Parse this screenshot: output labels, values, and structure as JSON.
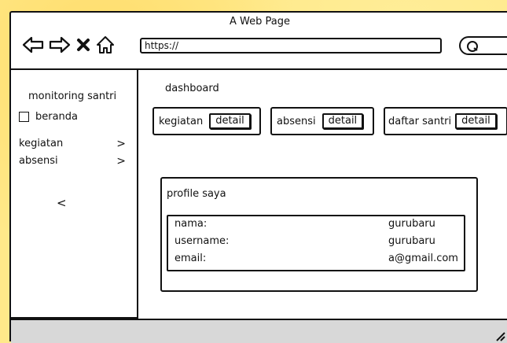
{
  "browser": {
    "title": "A Web Page",
    "url": "https://",
    "icons": [
      "back-arrow-icon",
      "forward-arrow-icon",
      "close-x-icon",
      "home-icon",
      "search-icon"
    ]
  },
  "sidebar": {
    "title": "monitoring santri",
    "home_label": "beranda",
    "items": [
      {
        "label": "kegiatan",
        "chevron": ">"
      },
      {
        "label": "absensi",
        "chevron": ">"
      }
    ],
    "collapse": "<"
  },
  "main": {
    "heading": "dashboard",
    "cards": [
      {
        "label": "kegiatan",
        "button": "detail"
      },
      {
        "label": "absensi",
        "button": "detail"
      },
      {
        "label": "daftar santri",
        "button": "detail"
      }
    ],
    "profile": {
      "title": "profile saya",
      "rows": [
        {
          "key": "nama:",
          "value": "gurubaru"
        },
        {
          "key": "username:",
          "value": "gurubaru"
        },
        {
          "key": "email:",
          "value": "a@gmail.com"
        }
      ]
    }
  }
}
